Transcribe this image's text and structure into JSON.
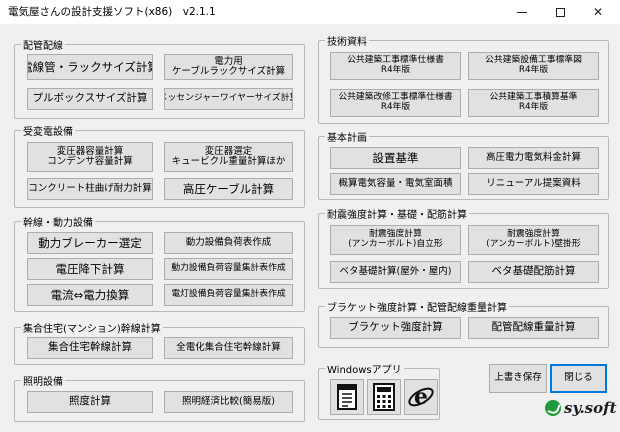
{
  "window": {
    "title": "電気屋さんの設計支援ソフト(x86)　v2.1.1",
    "minimize_icon": "minimize-icon",
    "maximize_icon": "maximize-icon",
    "close_glyph": "✕"
  },
  "haikan": {
    "label": "配管配線",
    "btn_conduit": "電線管・ラックサイズ計算",
    "btn_cable_rack_line1": "電力用",
    "btn_cable_rack_line2": "ケーブルラックサイズ計算",
    "btn_pullbox": "プルボックスサイズ計算",
    "btn_messenger": "メッセンジャーワイヤーサイズ計算"
  },
  "juhen": {
    "label": "受変電設備",
    "btn_trans_line1": "変圧器容量計算",
    "btn_trans_line2": "コンデンサ容量計算",
    "btn_cubicle_line1": "変圧器選定",
    "btn_cubicle_line2": "キュービクル重量計算ほか",
    "btn_concrete": "コンクリート柱曲げ耐力計算",
    "btn_hv_cable": "高圧ケーブル計算"
  },
  "kansen": {
    "label": "幹線・動力設備",
    "btn_breaker": "動力ブレーカー選定",
    "btn_power_load": "動力設備負荷表作成",
    "btn_vdrop": "電圧降下計算",
    "btn_power_summary": "動力設備負荷容量集計表作成",
    "btn_current": "電流⇔電力換算",
    "btn_light_summary": "電灯設備負荷容量集計表作成"
  },
  "mansion": {
    "label": "集合住宅(マンション)幹線計算",
    "btn_mansion": "集合住宅幹線計算",
    "btn_all_electric": "全電化集合住宅幹線計算"
  },
  "shomei": {
    "label": "照明設備",
    "btn_lux": "照度計算",
    "btn_economy": "照明経済比較(簡易版)"
  },
  "gijutsu": {
    "label": "技術資料",
    "btn_spec_line1": "公共建築工事標準仕様書",
    "btn_spec_line2": "R4年版",
    "btn_drawing_line1": "公共建築設備工事標準図",
    "btn_drawing_line2": "R4年版",
    "btn_renov_line1": "公共建築改修工事標準仕様書",
    "btn_renov_line2": "R4年版",
    "btn_estimate_line1": "公共建築工事積算基準",
    "btn_estimate_line2": "R4年版"
  },
  "kihon": {
    "label": "基本計画",
    "btn_standard": "設置基準",
    "btn_hv_fee": "高圧電力電気料金計算",
    "btn_capacity": "概算電気容量・電気室面積",
    "btn_renewal": "リニューアル提案資料"
  },
  "taishin": {
    "label": "耐震強度計算・基礎・配筋計算",
    "btn_anchor_free_line1": "耐震強度計算",
    "btn_anchor_free_line2": "(アンカーボルト)自立形",
    "btn_anchor_wall_line1": "耐震強度計算",
    "btn_anchor_wall_line2": "(アンカーボルト)壁掛形",
    "btn_base_calc": "ベタ基礎計算(屋外・屋内)",
    "btn_base_rebar": "ベタ基礎配筋計算"
  },
  "bracket": {
    "label": "ブラケット強度計算・配管配線重量計算",
    "btn_bracket": "ブラケット強度計算",
    "btn_weight": "配管配線重量計算"
  },
  "windows_apps": {
    "label": "Windowsアプリ",
    "notepad_icon": "notepad-icon",
    "calculator_icon": "calculator-icon",
    "ie_icon": "internet-explorer-icon"
  },
  "footer": {
    "save_label": "上書き保存",
    "close_label": "閉じる",
    "logo_text": "sy.soft"
  },
  "colors": {
    "accent": "#0078d7",
    "logo_green": "#1f9a3a"
  }
}
